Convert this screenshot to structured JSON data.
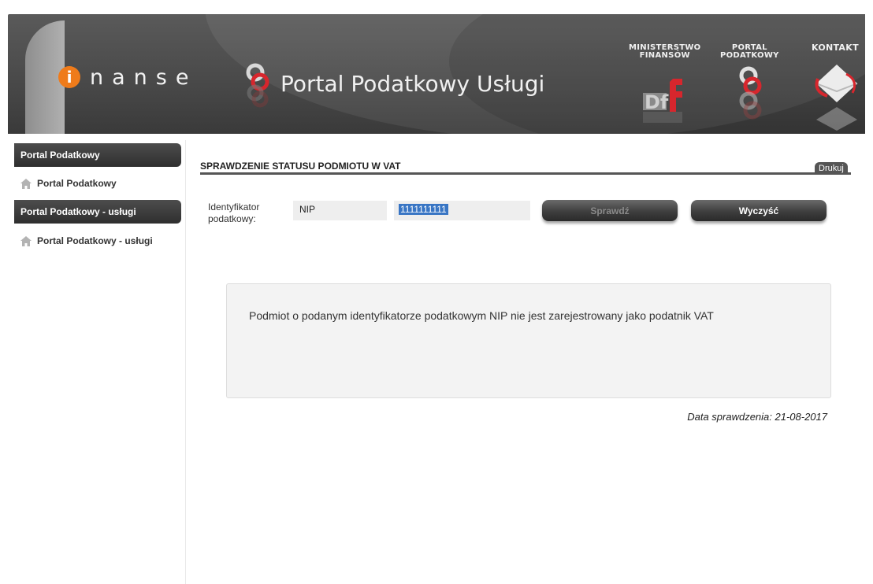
{
  "header": {
    "logo_i": "i",
    "logo_text": "nanse",
    "portal_title": "Portal Podatkowy Usługi",
    "links": [
      {
        "label": "MINISTERSTWO\nFINANSÓW",
        "icon": "mf-logo-icon"
      },
      {
        "label": "PORTAL\nPODATKOWY",
        "icon": "portal-podatkowy-icon"
      },
      {
        "label": "KONTAKT",
        "icon": "contact-envelope-icon"
      }
    ],
    "colors": {
      "accent": "#ef7b1a",
      "background": "#4a4a4a",
      "brand_red": "#d7262d"
    }
  },
  "sidebar": {
    "sections": [
      {
        "title": "Portal Podatkowy",
        "item": "Portal Podatkowy",
        "icon": "home-icon"
      },
      {
        "title": "Portal Podatkowy - usługi",
        "item": "Portal Podatkowy - usługi",
        "icon": "home-icon"
      }
    ]
  },
  "main": {
    "section_title": "SPRAWDZENIE STATUSU PODMIOTU W VAT",
    "print_label": "Drukuj",
    "form": {
      "id_label": "Identyfikator podatkowy:",
      "id_type": "NIP",
      "id_value": "1111111111",
      "check_button": "Sprawdź",
      "clear_button": "Wyczyść"
    },
    "result_message": "Podmiot o podanym identyfikatorze podatkowym NIP nie jest zarejestrowany jako podatnik VAT",
    "check_date": "Data sprawdzenia: 21-08-2017"
  }
}
